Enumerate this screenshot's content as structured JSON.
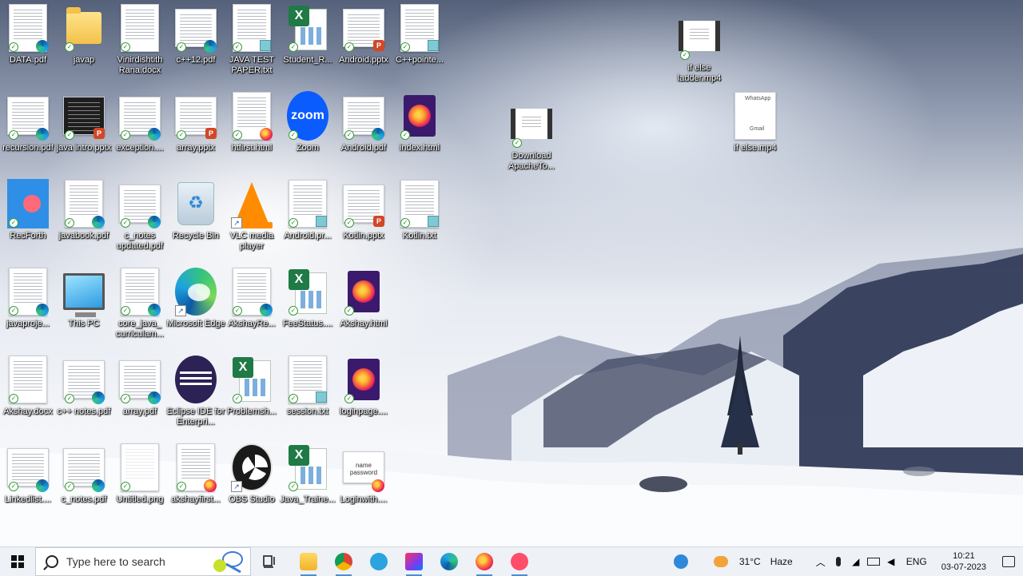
{
  "desktop": {
    "icons": [
      {
        "label": "DATA.pdf"
      },
      {
        "label": "javap"
      },
      {
        "label": "Vinirdishtith Rana.docx"
      },
      {
        "label": "c++12.pdf"
      },
      {
        "label": "JAVA TEST PAPER.txt"
      },
      {
        "label": "Student_R..."
      },
      {
        "label": "Android.pptx"
      },
      {
        "label": "C++pointe..."
      },
      {
        "label": "recursion.pdf"
      },
      {
        "label": "java intro.pptx"
      },
      {
        "label": "exception...."
      },
      {
        "label": "array.pptx"
      },
      {
        "label": "htfirst.html"
      },
      {
        "label": "Zoom"
      },
      {
        "label": "Android.pdf"
      },
      {
        "label": "index.html"
      },
      {
        "label": "RecForth"
      },
      {
        "label": "javabook.pdf"
      },
      {
        "label": "c_notes updated.pdf"
      },
      {
        "label": "Recycle Bin"
      },
      {
        "label": "VLC media player"
      },
      {
        "label": "Android.pr..."
      },
      {
        "label": "Kotlin.pptx"
      },
      {
        "label": "Kotlin.txt"
      },
      {
        "label": "javaproje..."
      },
      {
        "label": "This PC"
      },
      {
        "label": "core_java_ curriculam..."
      },
      {
        "label": "Microsoft Edge"
      },
      {
        "label": "AkshayRe..."
      },
      {
        "label": "FeeStatus...."
      },
      {
        "label": "Akshay.html"
      },
      {
        "label": "Akshay.docx"
      },
      {
        "label": "c++ notes.pdf"
      },
      {
        "label": "array.pdf"
      },
      {
        "label": "Eclipse IDE for Enterpri..."
      },
      {
        "label": "Problemsh..."
      },
      {
        "label": "session.txt"
      },
      {
        "label": "loginpage...."
      },
      {
        "label": "Linkedlist...."
      },
      {
        "label": "c_notes.pdf"
      },
      {
        "label": "Untitled.png"
      },
      {
        "label": "akshayfirst..."
      },
      {
        "label": "OBS Studio"
      },
      {
        "label": "Java_Traine..."
      },
      {
        "label": "Loginwith...."
      },
      {
        "label": "Download ApacheTo..."
      },
      {
        "label": "if else ladder.mp4"
      },
      {
        "label": "if else.mp4"
      }
    ],
    "thumb_text": {
      "login": "name password",
      "zoom": "zoom",
      "whatsapp": "WhatsApp",
      "gmail": "Gmail"
    }
  },
  "taskbar": {
    "search_placeholder": "Type here to search",
    "weather_temp": "31°C",
    "weather_desc": "Haze",
    "language": "ENG",
    "time": "10:21",
    "date": "03-07-2023"
  },
  "colors": {
    "taskbar_bg": "#eef1f6",
    "accent": "#4a8fd6"
  }
}
